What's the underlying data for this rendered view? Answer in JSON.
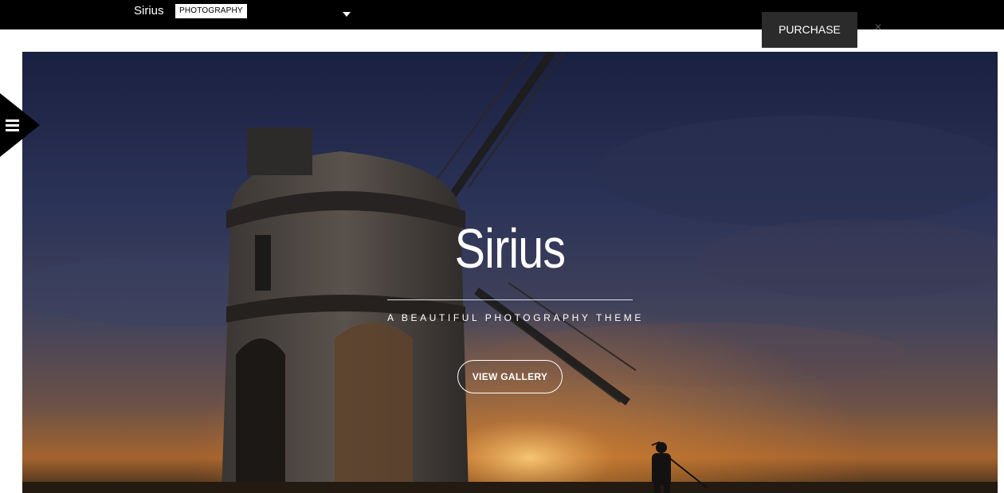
{
  "topbar": {
    "brand": "Sirius",
    "theme_badge": "PHOTOGRAPHY",
    "dropdown_icon": "caret-down-icon",
    "purchase_label": "PURCHASE",
    "close_icon": "close-icon"
  },
  "sidebar": {
    "menu_icon": "hamburger-menu-icon"
  },
  "hero": {
    "title": "Sirius",
    "subtitle": "A BEAUTIFUL PHOTOGRAPHY THEME",
    "button_label": "VIEW GALLERY",
    "background": "windmill-sunset-photo"
  },
  "colors": {
    "topbar_bg": "#000000",
    "purchase_bg": "#2b2b2b",
    "sky_top": "#1e2542",
    "sky_horizon": "#c9732e",
    "text": "#ffffff"
  }
}
